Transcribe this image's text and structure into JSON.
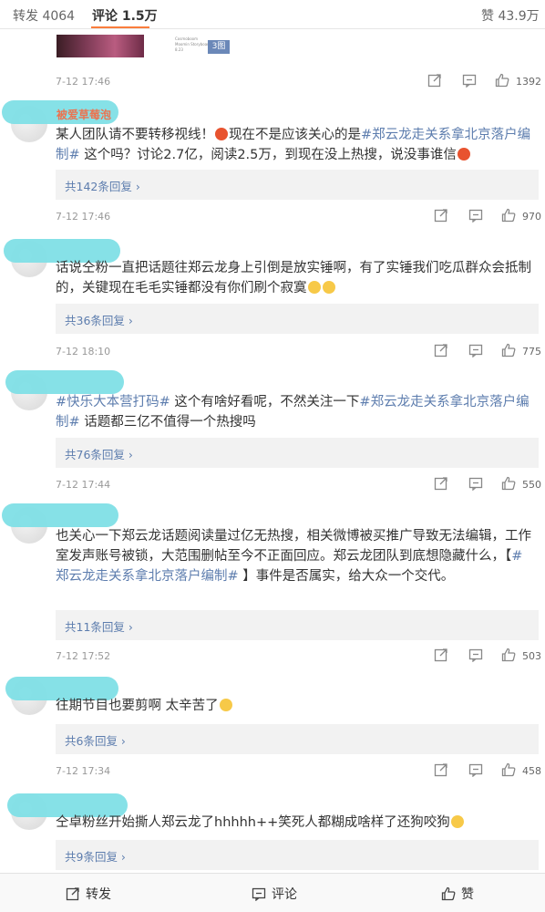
{
  "tabs": {
    "repost": "转发 4064",
    "comment": "评论 1.5万",
    "like": "赞 43.9万"
  },
  "header_item": {
    "thumb_text": "Cosmoboom Moomin Storyboard 8.23",
    "img_count": "3图",
    "time": "7-12 17:46",
    "likes": "1392"
  },
  "comments": [
    {
      "name": "被爱草莓泡",
      "text_parts": [
        "某人团队请不要转移视线！",
        "现在不是应该关心的是",
        "#郑云龙走关系拿北京落户编制#",
        " 这个吗？讨论2.7亿，阅读2.5万，到现在没上热搜，说没事谁信"
      ],
      "replies": "共142条回复 ›",
      "time": "7-12 17:46",
      "likes": "970"
    },
    {
      "text": "话说仝粉一直把话题往郑云龙身上引倒是放实锤啊，有了实锤我们吃瓜群众会抵制的，关键现在毛毛实锤都没有你们刷个寂寞",
      "replies": "共36条回复 ›",
      "time": "7-12 18:10",
      "likes": "775"
    },
    {
      "tag1": "#快乐大本营打码#",
      "mid": " 这个有啥好看呢，不然关注一下",
      "tag2": "#郑云龙走关系拿北京落户编制#",
      "tail": " 话题都三亿不值得一个热搜吗",
      "replies": "共76条回复 ›",
      "time": "7-12 17:44",
      "likes": "550"
    },
    {
      "pre": "也关心一下郑云龙话题阅读量过亿无热搜，相关微博被买推广导致无法编辑，工作室发声账号被锁，大范围删帖至今不正面回应。郑云龙团队到底想隐藏什么，【",
      "tag": "#郑云龙走关系拿北京落户编制#",
      "post": " 】事件是否属实，给大众一个交代。",
      "replies": "共11条回复 ›",
      "time": "7-12 17:52",
      "likes": "503"
    },
    {
      "text": "往期节目也要剪啊 太辛苦了",
      "replies": "共6条回复 ›",
      "time": "7-12 17:34",
      "likes": "458"
    },
    {
      "text": "仝卓粉丝开始撕人郑云龙了hhhhh++笑死人都糊成啥样了还狗咬狗",
      "replies": "共9条回复 ›"
    }
  ],
  "bottom_bar": {
    "repost": "转发",
    "comment": "评论",
    "like": "赞"
  }
}
